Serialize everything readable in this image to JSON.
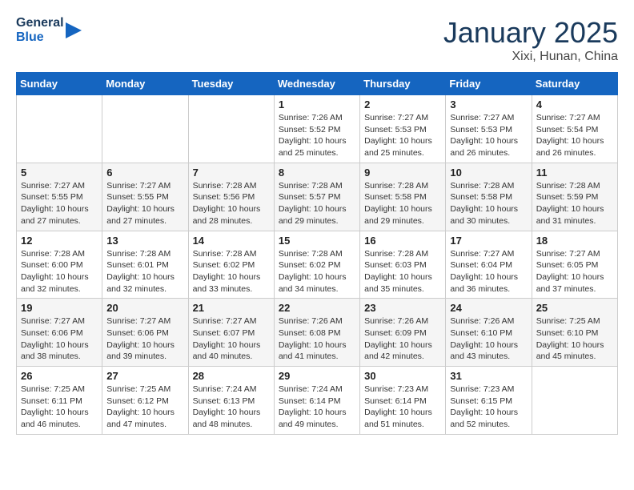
{
  "header": {
    "logo_line1": "General",
    "logo_line2": "Blue",
    "title": "January 2025",
    "subtitle": "Xixi, Hunan, China"
  },
  "weekdays": [
    "Sunday",
    "Monday",
    "Tuesday",
    "Wednesday",
    "Thursday",
    "Friday",
    "Saturday"
  ],
  "weeks": [
    [
      {
        "day": "",
        "info": ""
      },
      {
        "day": "",
        "info": ""
      },
      {
        "day": "",
        "info": ""
      },
      {
        "day": "1",
        "info": "Sunrise: 7:26 AM\nSunset: 5:52 PM\nDaylight: 10 hours\nand 25 minutes."
      },
      {
        "day": "2",
        "info": "Sunrise: 7:27 AM\nSunset: 5:53 PM\nDaylight: 10 hours\nand 25 minutes."
      },
      {
        "day": "3",
        "info": "Sunrise: 7:27 AM\nSunset: 5:53 PM\nDaylight: 10 hours\nand 26 minutes."
      },
      {
        "day": "4",
        "info": "Sunrise: 7:27 AM\nSunset: 5:54 PM\nDaylight: 10 hours\nand 26 minutes."
      }
    ],
    [
      {
        "day": "5",
        "info": "Sunrise: 7:27 AM\nSunset: 5:55 PM\nDaylight: 10 hours\nand 27 minutes."
      },
      {
        "day": "6",
        "info": "Sunrise: 7:27 AM\nSunset: 5:55 PM\nDaylight: 10 hours\nand 27 minutes."
      },
      {
        "day": "7",
        "info": "Sunrise: 7:28 AM\nSunset: 5:56 PM\nDaylight: 10 hours\nand 28 minutes."
      },
      {
        "day": "8",
        "info": "Sunrise: 7:28 AM\nSunset: 5:57 PM\nDaylight: 10 hours\nand 29 minutes."
      },
      {
        "day": "9",
        "info": "Sunrise: 7:28 AM\nSunset: 5:58 PM\nDaylight: 10 hours\nand 29 minutes."
      },
      {
        "day": "10",
        "info": "Sunrise: 7:28 AM\nSunset: 5:58 PM\nDaylight: 10 hours\nand 30 minutes."
      },
      {
        "day": "11",
        "info": "Sunrise: 7:28 AM\nSunset: 5:59 PM\nDaylight: 10 hours\nand 31 minutes."
      }
    ],
    [
      {
        "day": "12",
        "info": "Sunrise: 7:28 AM\nSunset: 6:00 PM\nDaylight: 10 hours\nand 32 minutes."
      },
      {
        "day": "13",
        "info": "Sunrise: 7:28 AM\nSunset: 6:01 PM\nDaylight: 10 hours\nand 32 minutes."
      },
      {
        "day": "14",
        "info": "Sunrise: 7:28 AM\nSunset: 6:02 PM\nDaylight: 10 hours\nand 33 minutes."
      },
      {
        "day": "15",
        "info": "Sunrise: 7:28 AM\nSunset: 6:02 PM\nDaylight: 10 hours\nand 34 minutes."
      },
      {
        "day": "16",
        "info": "Sunrise: 7:28 AM\nSunset: 6:03 PM\nDaylight: 10 hours\nand 35 minutes."
      },
      {
        "day": "17",
        "info": "Sunrise: 7:27 AM\nSunset: 6:04 PM\nDaylight: 10 hours\nand 36 minutes."
      },
      {
        "day": "18",
        "info": "Sunrise: 7:27 AM\nSunset: 6:05 PM\nDaylight: 10 hours\nand 37 minutes."
      }
    ],
    [
      {
        "day": "19",
        "info": "Sunrise: 7:27 AM\nSunset: 6:06 PM\nDaylight: 10 hours\nand 38 minutes."
      },
      {
        "day": "20",
        "info": "Sunrise: 7:27 AM\nSunset: 6:06 PM\nDaylight: 10 hours\nand 39 minutes."
      },
      {
        "day": "21",
        "info": "Sunrise: 7:27 AM\nSunset: 6:07 PM\nDaylight: 10 hours\nand 40 minutes."
      },
      {
        "day": "22",
        "info": "Sunrise: 7:26 AM\nSunset: 6:08 PM\nDaylight: 10 hours\nand 41 minutes."
      },
      {
        "day": "23",
        "info": "Sunrise: 7:26 AM\nSunset: 6:09 PM\nDaylight: 10 hours\nand 42 minutes."
      },
      {
        "day": "24",
        "info": "Sunrise: 7:26 AM\nSunset: 6:10 PM\nDaylight: 10 hours\nand 43 minutes."
      },
      {
        "day": "25",
        "info": "Sunrise: 7:25 AM\nSunset: 6:10 PM\nDaylight: 10 hours\nand 45 minutes."
      }
    ],
    [
      {
        "day": "26",
        "info": "Sunrise: 7:25 AM\nSunset: 6:11 PM\nDaylight: 10 hours\nand 46 minutes."
      },
      {
        "day": "27",
        "info": "Sunrise: 7:25 AM\nSunset: 6:12 PM\nDaylight: 10 hours\nand 47 minutes."
      },
      {
        "day": "28",
        "info": "Sunrise: 7:24 AM\nSunset: 6:13 PM\nDaylight: 10 hours\nand 48 minutes."
      },
      {
        "day": "29",
        "info": "Sunrise: 7:24 AM\nSunset: 6:14 PM\nDaylight: 10 hours\nand 49 minutes."
      },
      {
        "day": "30",
        "info": "Sunrise: 7:23 AM\nSunset: 6:14 PM\nDaylight: 10 hours\nand 51 minutes."
      },
      {
        "day": "31",
        "info": "Sunrise: 7:23 AM\nSunset: 6:15 PM\nDaylight: 10 hours\nand 52 minutes."
      },
      {
        "day": "",
        "info": ""
      }
    ]
  ]
}
